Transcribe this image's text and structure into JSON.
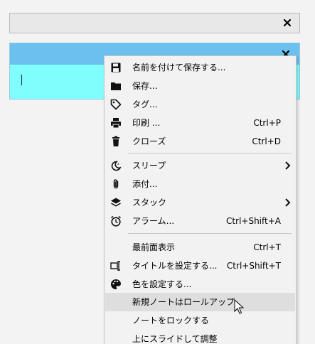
{
  "menu": {
    "items": [
      {
        "label": "名前を付けて保存する...",
        "shortcut": "",
        "icon": "save-icon"
      },
      {
        "label": "保存...",
        "shortcut": "",
        "icon": "folder-icon"
      },
      {
        "label": "タグ...",
        "shortcut": "",
        "icon": "tag-icon"
      },
      {
        "label": "印刷 ...",
        "shortcut": "Ctrl+P",
        "icon": "print-icon"
      },
      {
        "label": "クローズ",
        "shortcut": "Ctrl+D",
        "icon": "trash-icon"
      },
      {
        "label": "スリープ",
        "shortcut": "",
        "icon": "sleep-icon"
      },
      {
        "label": "添付...",
        "shortcut": "",
        "icon": "paperclip-icon"
      },
      {
        "label": "スタック",
        "shortcut": "",
        "icon": "layers-icon"
      },
      {
        "label": "アラーム...",
        "shortcut": "Ctrl+Shift+A",
        "icon": "alarm-icon"
      },
      {
        "label": "最前面表示",
        "shortcut": "Ctrl+T",
        "icon": ""
      },
      {
        "label": "タイトルを設定する...",
        "shortcut": "Ctrl+Shift+T",
        "icon": "title-icon"
      },
      {
        "label": "色を設定する...",
        "shortcut": "",
        "icon": "palette-icon"
      },
      {
        "label": "新規ノートはロールアップ",
        "shortcut": "",
        "icon": ""
      },
      {
        "label": "ノートをロックする",
        "shortcut": "",
        "icon": ""
      },
      {
        "label": "上にスライドして調整",
        "shortcut": "",
        "icon": ""
      }
    ]
  },
  "colors": {
    "note_titlebar": "#6cc0ef",
    "note_body": "#80fefe",
    "menu_bg": "#f2f2f2",
    "hover_bg": "#dedede"
  }
}
